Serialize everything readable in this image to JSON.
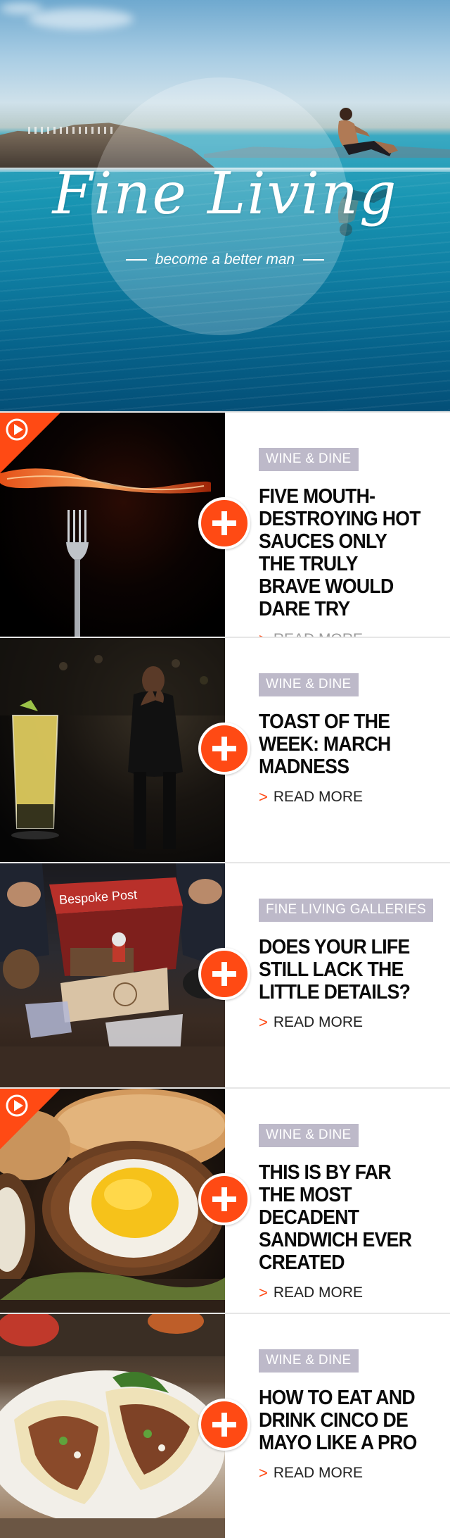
{
  "hero": {
    "title": "Fine Living",
    "tagline": "become a better man"
  },
  "articles": [
    {
      "category": "WINE & DINE",
      "headline": "FIVE MOUTH-DESTROYING HOT SAUCES ONLY THE TRULY BRAVE WOULD DARE TRY",
      "read_more": "READ MORE",
      "has_video": true
    },
    {
      "category": "WINE & DINE",
      "headline": "TOAST OF THE WEEK: MARCH MADNESS",
      "read_more": "READ MORE",
      "has_video": false
    },
    {
      "category": "FINE LIVING GALLERIES",
      "headline": "DOES YOUR LIFE STILL LACK THE LITTLE DETAILS?",
      "read_more": "READ MORE",
      "thumb_label": "Bespoke Post",
      "has_video": false
    },
    {
      "category": "WINE & DINE",
      "headline": "THIS IS BY FAR THE MOST DECADENT SANDWICH EVER CREATED",
      "read_more": "READ MORE",
      "has_video": true
    },
    {
      "category": "WINE & DINE",
      "headline": "HOW TO EAT AND DRINK CINCO DE MAYO LIKE A PRO",
      "read_more": "READ MORE",
      "has_video": false
    }
  ],
  "colors": {
    "accent": "#ff4a14",
    "category_bg": "#bdb9c9",
    "headline": "#0a0a0a"
  },
  "icons": {
    "read_more_arrow": "chevron-right-icon",
    "expand": "plus-icon",
    "video": "play-icon"
  }
}
